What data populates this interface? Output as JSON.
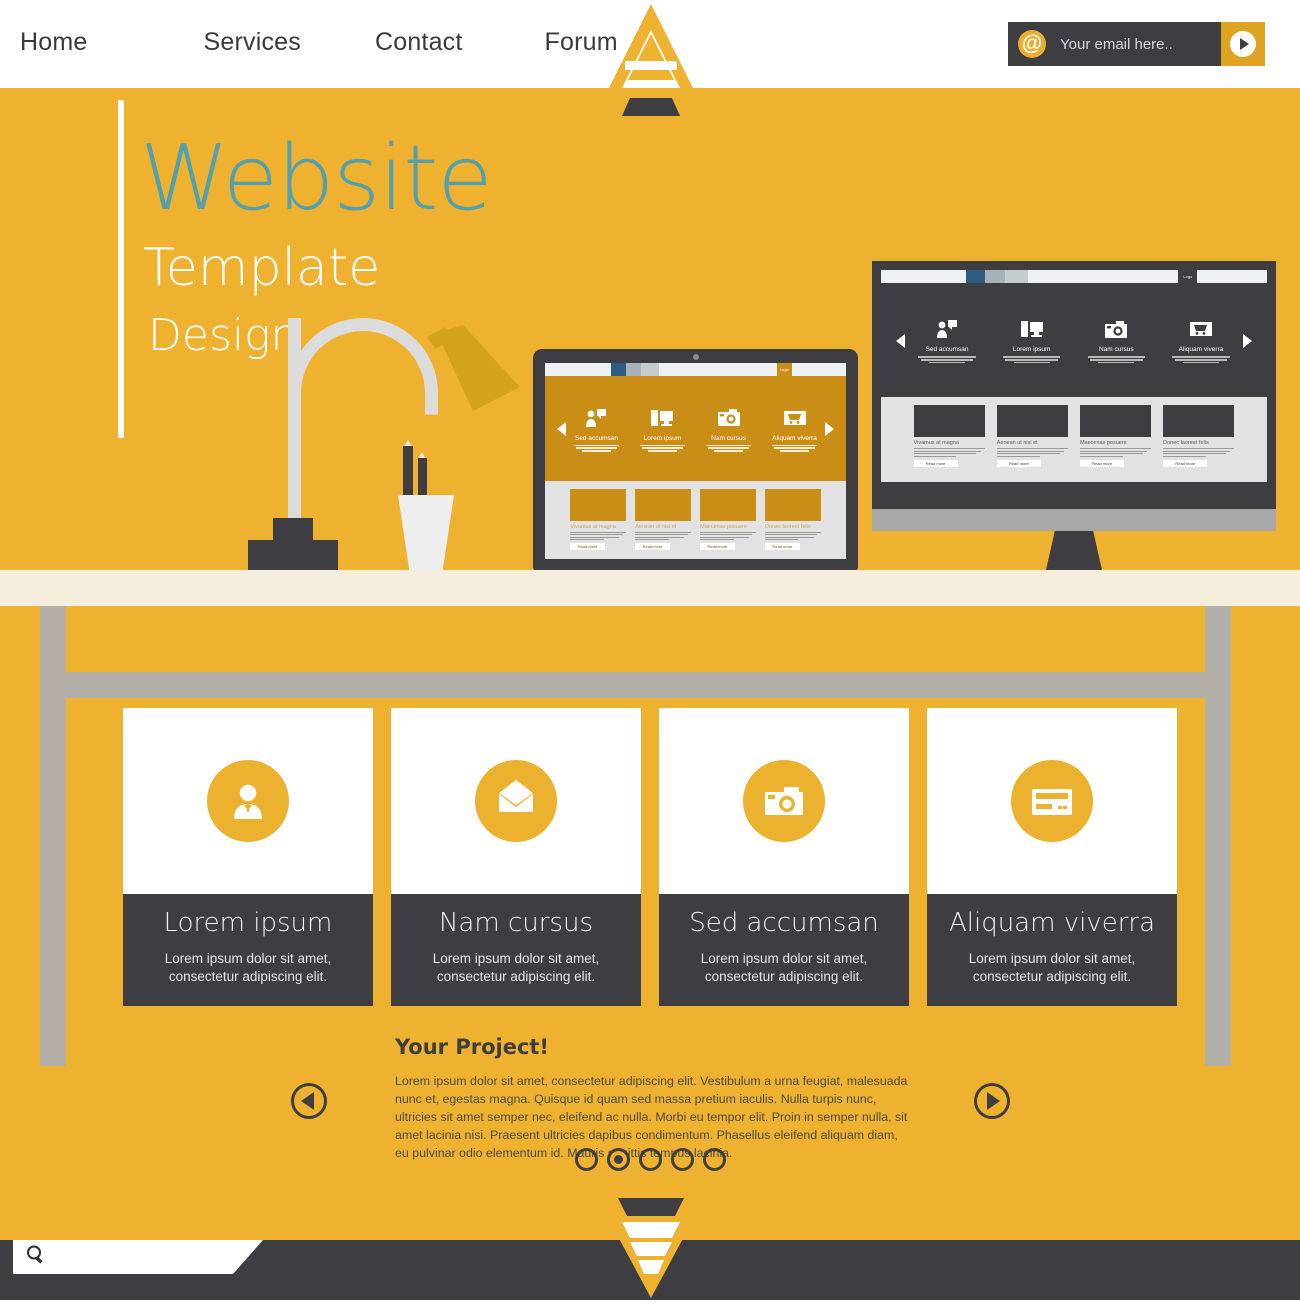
{
  "nav": {
    "items": [
      {
        "label": "Home"
      },
      {
        "label": "Services"
      },
      {
        "label": "Contact"
      },
      {
        "label": "Forum"
      }
    ]
  },
  "signup": {
    "at_symbol": "@",
    "placeholder": "Your email here..",
    "submit_label": ""
  },
  "hero": {
    "title": "Website",
    "subtitle1": "Template",
    "subtitle2": "Design",
    "title_color": "#54a0ad",
    "subtitle_color": "#ffffff"
  },
  "colors": {
    "background": "#efb230",
    "dark": "#3e3e42",
    "accent": "#edb130",
    "desk_top": "#f5eedd",
    "desk_leg": "#b2b0a8"
  },
  "mock_site": {
    "nav_titles": [
      "Sed accumsan",
      "Lorem ipsum",
      "Nam cursus",
      "Aliquam viverra"
    ],
    "nav_icons": [
      "user-screen-icon",
      "desktop-tower-icon",
      "camera-icon",
      "cart-icon"
    ],
    "card_titles": [
      "Vivamus at magna",
      "Aenean ut nisi et",
      "Maecenas posuere",
      "Donec laoreet felis"
    ],
    "card_button": "Read more",
    "logo_label": "Logo",
    "arrow_prev": "prev",
    "arrow_next": "next"
  },
  "cards": [
    {
      "icon": "user-icon",
      "title": "Lorem ipsum",
      "text": "Lorem ipsum dolor sit amet, consectetur adipiscing elit."
    },
    {
      "icon": "envelope-icon",
      "title": "Nam cursus",
      "text": "Lorem ipsum dolor sit amet, consectetur adipiscing elit."
    },
    {
      "icon": "camera-icon",
      "title": "Sed accumsan",
      "text": "Lorem ipsum dolor sit amet, consectetur adipiscing elit."
    },
    {
      "icon": "credit-card-icon",
      "title": "Aliquam viverra",
      "text": "Lorem ipsum dolor sit amet, consectetur adipiscing elit."
    }
  ],
  "project": {
    "heading": "Your Project!",
    "body": "Lorem ipsum dolor sit amet, consectetur adipiscing elit. Vestibulum a urna feugiat, malesuada nunc et, egestas magna. Quisque id quam sed massa pretium iaculis. Nulla turpis nunc, ultricies sit amet semper nec, eleifend ac nulla. Morbi eu tempor elit. Proin in semper nulla, sit amet lacinia nisi. Praesent ultricies dapibus condimentum. Phasellus eleifend aliquam diam, eu pulvinar odio elementum id. Mauris sagittis tempus lacinia.",
    "dots_total": 5,
    "dots_active_index": 1
  },
  "footer": {
    "search_placeholder": ""
  }
}
